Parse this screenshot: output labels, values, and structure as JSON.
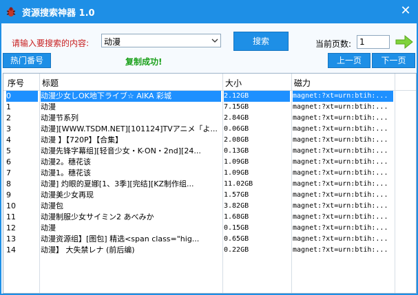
{
  "window": {
    "title": "资源搜索神器 1.0",
    "close_glyph": "✕"
  },
  "search": {
    "label": "请输入要搜索的内容:",
    "value": "动漫",
    "button": "搜索"
  },
  "pager": {
    "label": "当前页数:",
    "value": "1",
    "prev": "上一页",
    "next": "下一页"
  },
  "hot_button": "热门番号",
  "status_message": "复制成功!",
  "table": {
    "columns": [
      "序号",
      "标题",
      "大小",
      "磁力"
    ],
    "selected_row": 0,
    "rows": [
      {
        "no": "0",
        "title": "动漫少女しOK地下ライブ☆ AIKA 彩城",
        "size": "2.12GB",
        "magnet": "magnet:?xt=urn:btih:..."
      },
      {
        "no": "1",
        "title": "动漫",
        "size": "7.15GB",
        "magnet": "magnet:?xt=urn:btih:..."
      },
      {
        "no": "2",
        "title": "动漫节系列",
        "size": "2.84GB",
        "magnet": "magnet:?xt=urn:btih:..."
      },
      {
        "no": "3",
        "title": "动漫][WWW.TSDM.NET][101124]TVアニメ「よ...",
        "size": "0.06GB",
        "magnet": "magnet:?xt=urn:btih:..."
      },
      {
        "no": "4",
        "title": "动漫 】【720P】【合集】",
        "size": "2.08GB",
        "magnet": "magnet:?xt=urn:btih:..."
      },
      {
        "no": "5",
        "title": "动漫先锋字幕组][轻音少女・K-ON・2nd][24...",
        "size": "0.13GB",
        "magnet": "magnet:?xt=urn:btih:..."
      },
      {
        "no": "6",
        "title": "动漫2。穗花该",
        "size": "1.09GB",
        "magnet": "magnet:?xt=urn:btih:..."
      },
      {
        "no": "7",
        "title": "动漫1。穗花该",
        "size": "1.09GB",
        "magnet": "magnet:?xt=urn:btih:..."
      },
      {
        "no": "8",
        "title": "动漫] 灼眼的夏娜[1、3季][完结][KZ制作组...",
        "size": "11.02GB",
        "magnet": "magnet:?xt=urn:btih:..."
      },
      {
        "no": "9",
        "title": "动漫美少女再现",
        "size": "1.57GB",
        "magnet": "magnet:?xt=urn:btih:..."
      },
      {
        "no": "10",
        "title": "动漫包",
        "size": "3.82GB",
        "magnet": "magnet:?xt=urn:btih:..."
      },
      {
        "no": "11",
        "title": "动漫制服少女サイミン2 あべみか",
        "size": "1.68GB",
        "magnet": "magnet:?xt=urn:btih:..."
      },
      {
        "no": "12",
        "title": "动漫",
        "size": "0.15GB",
        "magnet": "magnet:?xt=urn:btih:..."
      },
      {
        "no": "13",
        "title": "动漫资源组】[图包] 精选<span class=\"hig...",
        "size": "0.65GB",
        "magnet": "magnet:?xt=urn:btih:..."
      },
      {
        "no": "14",
        "title": "动漫】 大失禁レナ (前后编)",
        "size": "0.22GB",
        "magnet": "magnet:?xt=urn:btih:..."
      }
    ]
  },
  "colors": {
    "accent": "#1e8fe6",
    "label_red": "#c81e1e",
    "success_green": "#1aa01a",
    "selection": "#1e90ff"
  },
  "icons": {
    "app": "bug-icon",
    "close": "close-icon",
    "dropdown": "chevron-down-icon",
    "next_page": "arrow-right-icon"
  }
}
